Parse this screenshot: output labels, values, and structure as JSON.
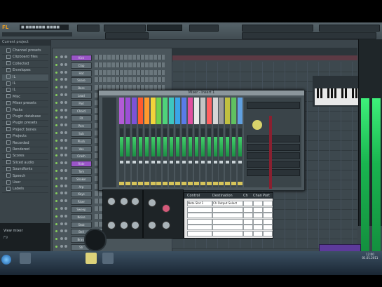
{
  "app": {
    "logo": "FL",
    "project_title": "■ ■■■■■■ ■■■■"
  },
  "browser": {
    "header": "Current project",
    "items": [
      {
        "label": "Channel presets"
      },
      {
        "label": "Clipboard files"
      },
      {
        "label": "Collected"
      },
      {
        "label": "Envelopes"
      },
      {
        "label": "IL"
      },
      {
        "label": "IL"
      },
      {
        "label": "IL"
      },
      {
        "label": "Misc"
      },
      {
        "label": "Mixer presets"
      },
      {
        "label": "Packs"
      },
      {
        "label": "Plugin database"
      },
      {
        "label": "Plugin presets"
      },
      {
        "label": "Project bones"
      },
      {
        "label": "Projects"
      },
      {
        "label": "Recorded"
      },
      {
        "label": "Rendered"
      },
      {
        "label": "Scores"
      },
      {
        "label": "Sliced audio"
      },
      {
        "label": "Soundfonts"
      },
      {
        "label": "Speech"
      },
      {
        "label": "User"
      },
      {
        "label": "Labels"
      }
    ],
    "hint_title": "View mixer",
    "hint_sub": "F9"
  },
  "mixer": {
    "title": "Mixer - Insert 1",
    "strip_colors": [
      "#b25bd6",
      "#9c4fd6",
      "#7d52d8",
      "#ff5b2e",
      "#ff9a2e",
      "#f2d43a",
      "#73d24a",
      "#4fd27a",
      "#3ec6c0",
      "#3aa6e8",
      "#5a7be8",
      "#e04fa0",
      "#e8e8e8",
      "#c4c4c4",
      "#ff6060",
      "#d6d6d6",
      "#9a9a9a",
      "#c0c040",
      "#60c060",
      "#60a0e0"
    ]
  },
  "sequencer": {
    "channels": [
      "Kick",
      "Clap",
      "Hat",
      "Snare",
      "Bass",
      "Lead",
      "Pad",
      "Chord",
      "FX",
      "Perc",
      "Sub",
      "Pluck",
      "Vox",
      "Crash",
      "Ride",
      "Tom",
      "Shaker",
      "Arp",
      "Keys",
      "Riser",
      "Sweep",
      "Noise",
      "Stab",
      "Bell",
      "Brass",
      "Str"
    ]
  },
  "grid": {
    "headers": [
      "Control",
      "Destination",
      "Ch",
      "Chan",
      "Port"
    ],
    "rows": [
      [
        "Note Slot 1",
        "Ch Output Select",
        "",
        "",
        ""
      ],
      [
        "",
        "",
        "",
        "",
        ""
      ],
      [
        "",
        "",
        "",
        "",
        ""
      ],
      [
        "",
        "",
        "",
        "",
        ""
      ],
      [
        "",
        "",
        "",
        "",
        ""
      ],
      [
        "",
        "",
        "",
        "",
        ""
      ]
    ]
  },
  "taskbar": {
    "clock_time": "12:00",
    "clock_date": "01.01.2011"
  },
  "colors": {
    "accent_green": "#3ef07a",
    "purple_button": "#9a55c7",
    "panel_bg": "#3b454b"
  }
}
